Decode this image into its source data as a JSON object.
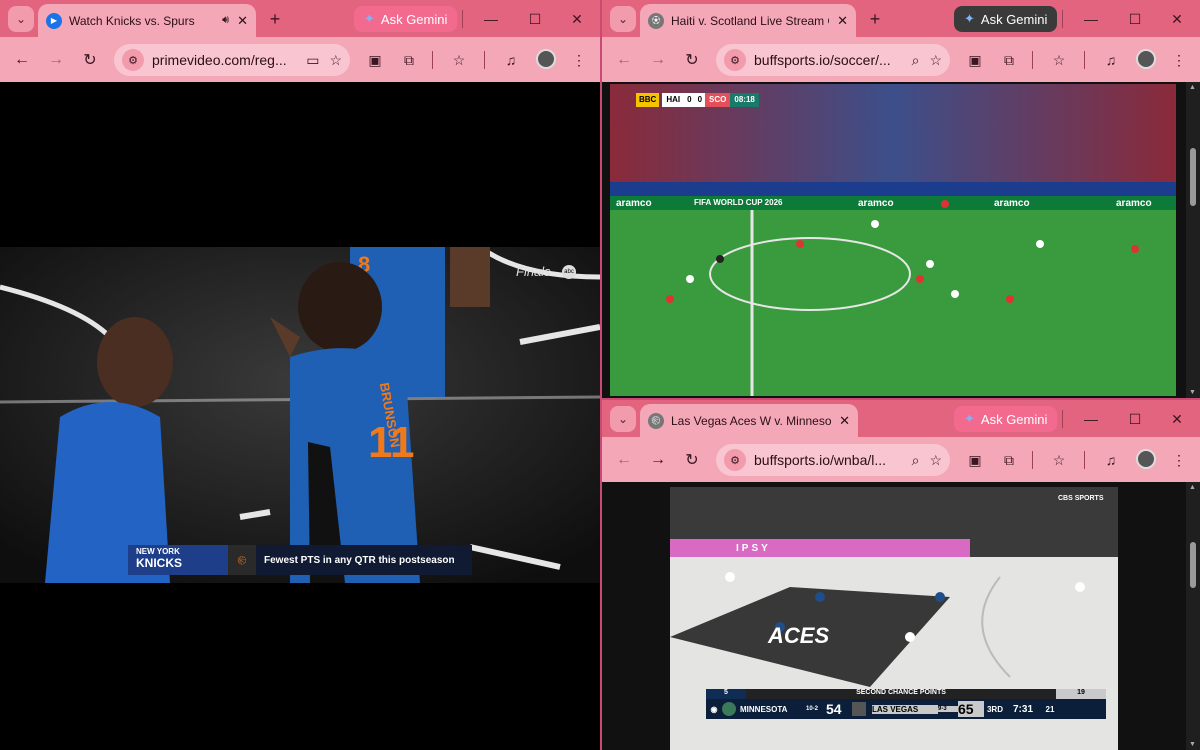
{
  "left": {
    "tab": {
      "title": "Watch Knicks vs. Spurs",
      "close": "✕"
    },
    "new_tab": "+",
    "gemini": "Ask Gemini",
    "url": "primevideo.com/reg...",
    "video": {
      "watermark": "Finals",
      "network": "abc",
      "player_name": "BRUNSON",
      "player_number": "11",
      "banner_team": "NEW YORK",
      "banner_team2": "KNICKS",
      "banner_stat": "Fewest PTS in any QTR this postseason"
    }
  },
  "top_right": {
    "tab": {
      "title": "Haiti v. Scotland Live Stream Or",
      "close": "✕"
    },
    "new_tab": "+",
    "gemini": "Ask Gemini",
    "url": "buffsports.io/soccer/...",
    "score": {
      "network": "BBC",
      "home": "HAI",
      "home_score": "0",
      "away_score": "0",
      "away": "SCO",
      "clock": "08:18"
    },
    "boards": [
      "aramco",
      "FIFA WORLD CUP 2026",
      "aramco",
      "aramco",
      "aramco"
    ]
  },
  "bottom_right": {
    "tab": {
      "title": "Las Vegas Aces W v. Minnesota",
      "close": "✕"
    },
    "gemini": "Ask Gemini",
    "url": "buffsports.io/wnba/l...",
    "network": "CBS SPORTS",
    "ad": "IPSY",
    "court": "ACES",
    "score": {
      "left_num": "5",
      "middle": "SECOND CHANCE POINTS",
      "right_num": "19",
      "away": "MINNESOTA",
      "away_record": "10-2",
      "away_score": "54",
      "home": "LAS VEGAS",
      "home_record": "9-3",
      "home_score": "65",
      "quarter": "3RD",
      "clock": "7:31",
      "shot": "21"
    }
  },
  "colors": {
    "frame": "#e3647f",
    "toolbar": "#f4a7b7",
    "omnibox": "#f8c5d0",
    "accent": "#f26b8e"
  }
}
